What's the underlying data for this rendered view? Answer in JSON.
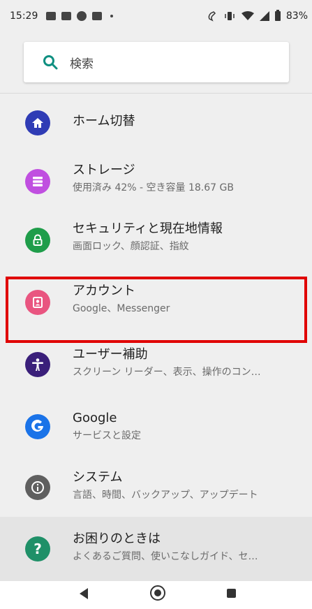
{
  "status_bar": {
    "time": "15:29",
    "battery": "83%"
  },
  "search": {
    "placeholder": "検索",
    "icon": "search-icon"
  },
  "items": [
    {
      "title": "ホーム切替",
      "subtitle": "",
      "icon": "home-icon",
      "color": "#2f3cb5"
    },
    {
      "title": "ストレージ",
      "subtitle": "使用済み 42% - 空き容量 18.67 GB",
      "icon": "storage-icon",
      "color": "#c04fe0"
    },
    {
      "title": "セキュリティと現在地情報",
      "subtitle": "画面ロック、顔認証、指紋",
      "icon": "lock-icon",
      "color": "#1f9d4a"
    },
    {
      "title": "アカウント",
      "subtitle": "Google、Messenger",
      "icon": "account-icon",
      "color": "#e95580"
    },
    {
      "title": "ユーザー補助",
      "subtitle": "スクリーン リーダー、表示、操作のコン…",
      "icon": "accessibility-icon",
      "color": "#3a1f7a"
    },
    {
      "title": "Google",
      "subtitle": "サービスと設定",
      "icon": "google-icon",
      "color": "#1a73e8"
    },
    {
      "title": "システム",
      "subtitle": "言語、時間、バックアップ、アップデート",
      "icon": "info-icon",
      "color": "#5f5f5f"
    },
    {
      "title": "お困りのときは",
      "subtitle": "よくあるご質問、使いこなしガイド、セ…",
      "icon": "help-icon",
      "color": "#1f9068"
    }
  ],
  "highlight_item": "アカウント"
}
